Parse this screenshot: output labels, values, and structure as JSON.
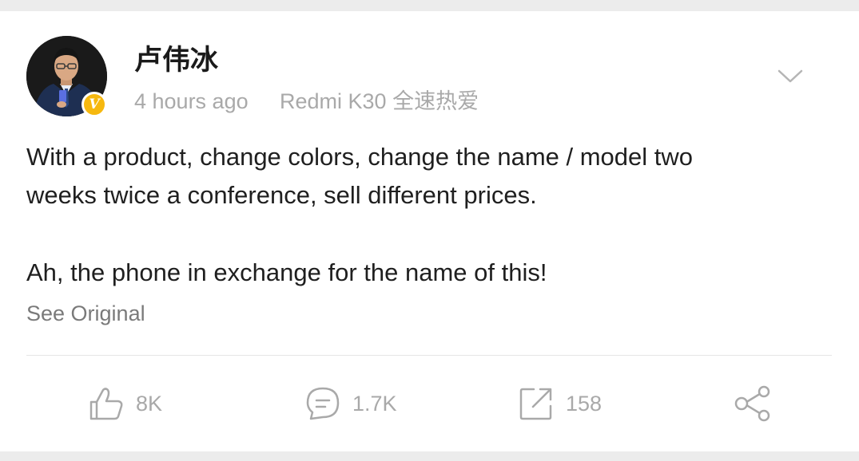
{
  "post": {
    "author": "卢伟冰",
    "time": "4 hours ago",
    "source": "Redmi K30 全速热爱",
    "verified_badge": "V",
    "lines": [
      "With a product, change colors, change the name / model two",
      "weeks twice a conference, sell different prices.",
      "Ah, the phone in exchange for the name of this!"
    ],
    "see_original": "See Original"
  },
  "actions": {
    "likes": "8K",
    "comments": "1.7K",
    "reposts": "158"
  },
  "colors": {
    "badge": "#f6b80f",
    "text": "#1f1f1f",
    "muted": "#a9a9a9",
    "background": "#ececec"
  },
  "icons": [
    "chevron-down-icon",
    "thumbs-up-icon",
    "comment-icon",
    "repost-icon",
    "share-icon",
    "verified-icon"
  ]
}
